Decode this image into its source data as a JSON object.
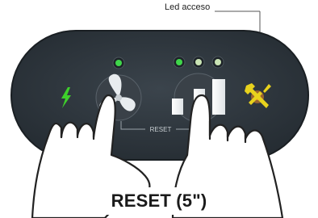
{
  "callout": {
    "label": "Led acceso"
  },
  "panel": {
    "reset_label": "RESET",
    "led_colors": {
      "fan": "#3fd64a",
      "bar_1": "#3fd64a",
      "bar_2": "#c9e3b4",
      "bar_3": "#c9e3b4"
    },
    "power_icon_color": "#3ecf2b",
    "alarm_led_color": "#f08a24",
    "alarm_icon_color": "#e8d21d"
  },
  "caption": {
    "text": "RESET (5\")"
  },
  "icons": [
    "lightning-icon",
    "fan-icon",
    "bar-level-icon",
    "wrench-screwdriver-icon",
    "pointing-hand-left",
    "pointing-hand-right"
  ]
}
